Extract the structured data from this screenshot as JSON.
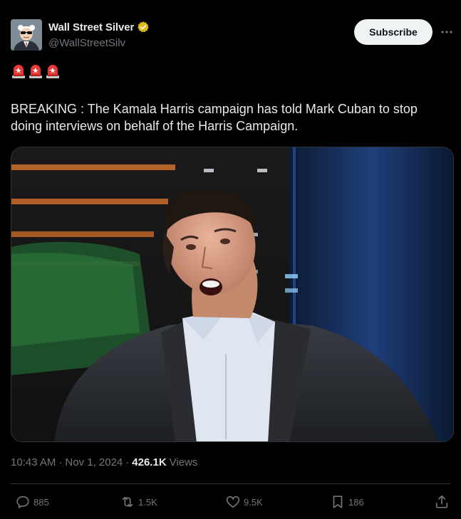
{
  "author": {
    "display_name": "Wall Street Silver",
    "handle": "@WallStreetSilv",
    "verified_icon": "gold-verified-badge-icon",
    "avatar_icon": "cartoon-man-sunglasses-avatar"
  },
  "header": {
    "subscribe_label": "Subscribe",
    "more_icon": "more-horizontal-icon"
  },
  "tweet": {
    "emoji": [
      "police-siren",
      "police-siren",
      "police-siren"
    ],
    "text": "BREAKING : The Kamala Harris campaign has told Mark Cuban to stop doing interviews on behalf of the Harris Campaign.",
    "media_icon": "photo-man-in-suit-reclining"
  },
  "meta": {
    "time": "10:43 AM",
    "sep1": "·",
    "date": "Nov 1, 2024",
    "sep2": "·",
    "views_count": "426.1K",
    "views_label": "Views"
  },
  "actions": {
    "replies": "885",
    "reposts": "1.5K",
    "likes": "9.5K",
    "bookmarks": "186"
  },
  "colors": {
    "background": "#000000",
    "text": "#e7e9ea",
    "secondary_text": "#71767b",
    "subscribe_bg": "#eff3f4",
    "verified_gold": "#e2b719",
    "divider": "#2f3336"
  }
}
